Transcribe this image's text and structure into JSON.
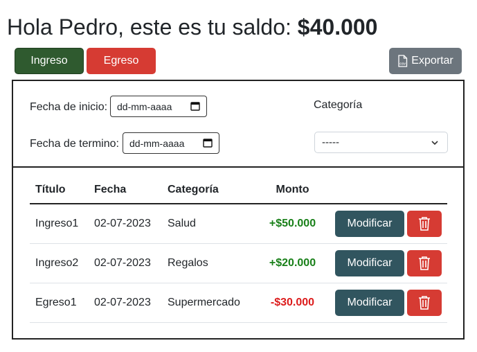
{
  "header": {
    "greeting": "Hola Pedro, este es tu saldo:",
    "balance": "$40.000"
  },
  "toolbar": {
    "ingreso_label": "Ingreso",
    "egreso_label": "Egreso",
    "export_label": "Exportar",
    "export_icon": "csv-file-icon"
  },
  "filters": {
    "start_label": "Fecha de inicio:",
    "start_placeholder": "dd-mm-aaaa",
    "end_label": "Fecha de termino:",
    "end_placeholder": "dd-mm-aaaa",
    "category_label": "Categoría",
    "category_value": "-----"
  },
  "table": {
    "headers": [
      "Título",
      "Fecha",
      "Categoría",
      "Monto"
    ],
    "rows": [
      {
        "titulo": "Ingreso1",
        "fecha": "02-07-2023",
        "categoria": "Salud",
        "monto": "+$50.000",
        "type": "pos"
      },
      {
        "titulo": "Ingreso2",
        "fecha": "02-07-2023",
        "categoria": "Regalos",
        "monto": "+$20.000",
        "type": "pos"
      },
      {
        "titulo": "Egreso1",
        "fecha": "02-07-2023",
        "categoria": "Supermercado",
        "monto": "-$30.000",
        "type": "neg"
      }
    ],
    "modify_label": "Modificar"
  },
  "colors": {
    "ingreso": "#2f5a2f",
    "egreso": "#d63b33",
    "export": "#6c757d",
    "modify": "#31555f",
    "positive": "#198019",
    "negative": "#dc1c1c"
  }
}
